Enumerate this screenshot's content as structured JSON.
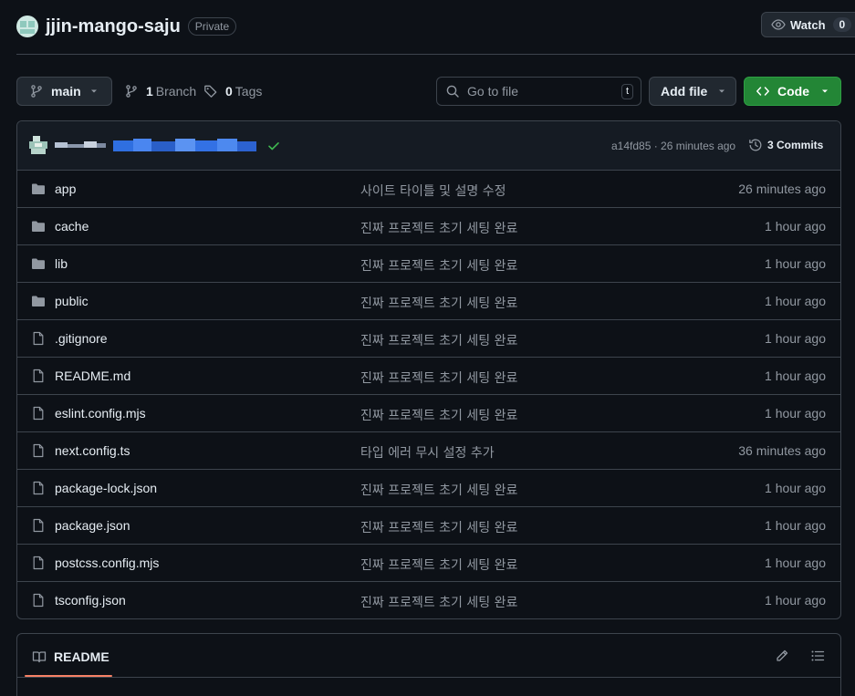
{
  "repo": {
    "name": "jjin-mango-saju",
    "visibility": "Private",
    "watch_label": "Watch",
    "watch_count": "0"
  },
  "toolbar": {
    "branch": "main",
    "branch_count": "1",
    "branch_label": "Branch",
    "tag_count": "0",
    "tag_label": "Tags",
    "search_placeholder": "Go to file",
    "search_shortcut": "t",
    "add_file_label": "Add file",
    "code_label": "Code"
  },
  "latest_commit": {
    "hash_time": "a14fd85 · 26 minutes ago",
    "commits_label": "3 Commits",
    "status": "success"
  },
  "files": [
    {
      "name": "app",
      "type": "folder",
      "message": "사이트 타이틀 및 설명 수정",
      "time": "26 minutes ago"
    },
    {
      "name": "cache",
      "type": "folder",
      "message": "진짜 프로젝트 초기 세팅 완료",
      "time": "1 hour ago"
    },
    {
      "name": "lib",
      "type": "folder",
      "message": "진짜 프로젝트 초기 세팅 완료",
      "time": "1 hour ago"
    },
    {
      "name": "public",
      "type": "folder",
      "message": "진짜 프로젝트 초기 세팅 완료",
      "time": "1 hour ago"
    },
    {
      "name": ".gitignore",
      "type": "file",
      "message": "진짜 프로젝트 초기 세팅 완료",
      "time": "1 hour ago"
    },
    {
      "name": "README.md",
      "type": "file",
      "message": "진짜 프로젝트 초기 세팅 완료",
      "time": "1 hour ago"
    },
    {
      "name": "eslint.config.mjs",
      "type": "file",
      "message": "진짜 프로젝트 초기 세팅 완료",
      "time": "1 hour ago"
    },
    {
      "name": "next.config.ts",
      "type": "file",
      "message": "타입 에러 무시 설정 추가",
      "time": "36 minutes ago"
    },
    {
      "name": "package-lock.json",
      "type": "file",
      "message": "진짜 프로젝트 초기 세팅 완료",
      "time": "1 hour ago"
    },
    {
      "name": "package.json",
      "type": "file",
      "message": "진짜 프로젝트 초기 세팅 완료",
      "time": "1 hour ago"
    },
    {
      "name": "postcss.config.mjs",
      "type": "file",
      "message": "진짜 프로젝트 초기 세팅 완료",
      "time": "1 hour ago"
    },
    {
      "name": "tsconfig.json",
      "type": "file",
      "message": "진짜 프로젝트 초기 세팅 완료",
      "time": "1 hour ago"
    }
  ],
  "readme": {
    "tab_label": "README"
  },
  "colors": {
    "accent_green": "#238636",
    "success_check": "#3fb950",
    "underline": "#f78166"
  }
}
